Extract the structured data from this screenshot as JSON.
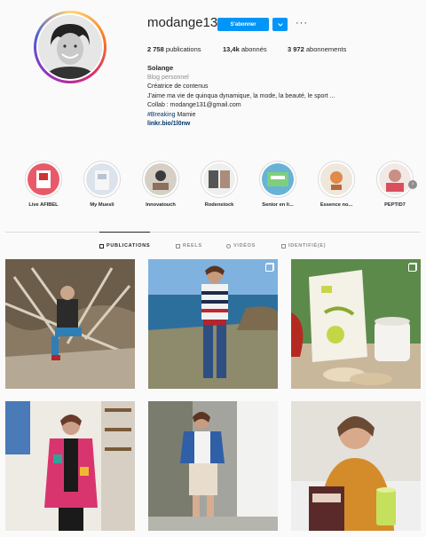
{
  "profile": {
    "username": "modange13",
    "follow_label": "S'abonner",
    "more_label": "···",
    "stats": [
      {
        "value": "2 758",
        "label": "publications"
      },
      {
        "value": "13,4k",
        "label": "abonnés"
      },
      {
        "value": "3 972",
        "label": "abonnements"
      }
    ],
    "name": "Solange",
    "category": "Blog personnel",
    "bio_line1": "Créatrice de contenus",
    "bio_line2": "J'aime ma vie de quinqua dynamique, la mode, la beauté, le sport ...",
    "bio_line3": "Collab : modange131@gmail.com",
    "hashtag": "#Breaking",
    "hashtag_suffix": " Mamie",
    "link": "linkr.bio/1l0nw"
  },
  "highlights": [
    {
      "label": "Live AFIBEL"
    },
    {
      "label": "My Muesli"
    },
    {
      "label": "Innovatouch"
    },
    {
      "label": "Rodenstock"
    },
    {
      "label": "Senior en li..."
    },
    {
      "label": "Essence no..."
    },
    {
      "label": "PEPTID7"
    }
  ],
  "tabs": [
    {
      "label": "PUBLICATIONS"
    },
    {
      "label": "REELS"
    },
    {
      "label": "VIDÉOS"
    },
    {
      "label": "IDENTIFIÉ(E)"
    }
  ],
  "colors": {
    "accent": "#0095f6",
    "link": "#00376b",
    "muted": "#8e8e8e"
  }
}
